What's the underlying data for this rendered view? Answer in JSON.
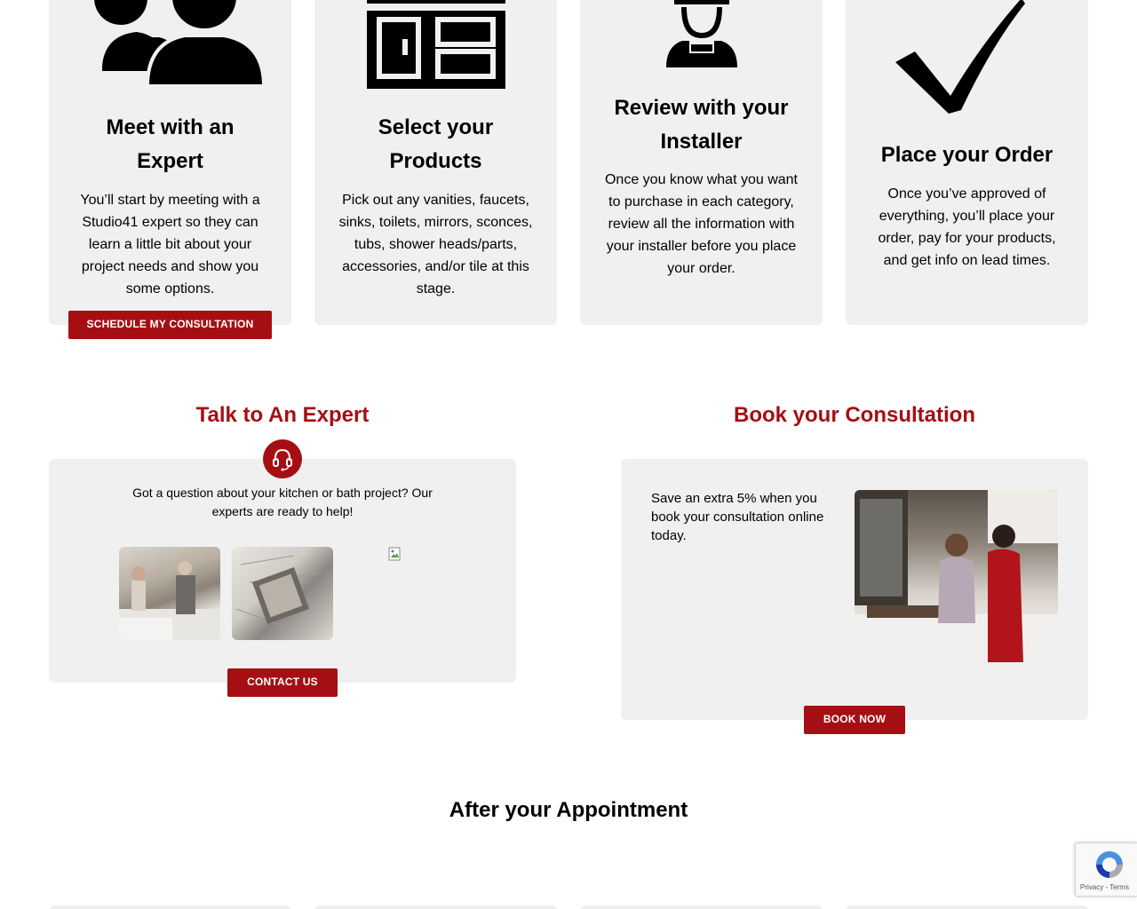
{
  "steps": [
    {
      "icon": "users-icon",
      "title_line1": "Meet with an",
      "title_line2": "Expert",
      "text": [
        "You’ll start by meeting with a",
        "Studio41 expert so they can",
        "learn a little bit about your",
        "project needs and show you",
        "some options."
      ],
      "button": "SCHEDULE MY CONSULTATION"
    },
    {
      "icon": "cabinet-icon",
      "title_line1": "Select your",
      "title_line2": "Products",
      "text": [
        "Pick out any vanities, faucets,",
        "sinks, toilets, mirrors, sconces,",
        "tubs, shower heads/parts,",
        "accessories, and/or tile at this",
        "stage."
      ]
    },
    {
      "icon": "installer-icon",
      "title_line1": "Review with your",
      "title_line2": "Installer",
      "text": [
        "Once you know what you want",
        "to purchase in each category,",
        "review all the information with",
        "your installer before you place",
        "your order."
      ]
    },
    {
      "icon": "checkmark-icon",
      "title_line1": "Place your Order",
      "text": [
        "Once you’ve approved of",
        "everything, you’ll place your",
        "order, pay for your products,",
        "and get info on lead times."
      ]
    }
  ],
  "expert": {
    "title": "Talk to An Expert",
    "icon": "headset-icon",
    "text_line1": "Got a question about your kitchen or bath project? Our",
    "text_line2": "experts are ready to help!",
    "button": "CONTACT US"
  },
  "consultation": {
    "title": "Book your Consultation",
    "text": [
      "Save an extra 5% when you",
      "book your consultation online",
      "today."
    ],
    "button": "BOOK NOW"
  },
  "after": {
    "title": "After your Appointment"
  },
  "recaptcha": {
    "links": "Privacy - Terms"
  },
  "colors": {
    "accent": "#a50f13",
    "card_bg": "#f0f0f0"
  }
}
